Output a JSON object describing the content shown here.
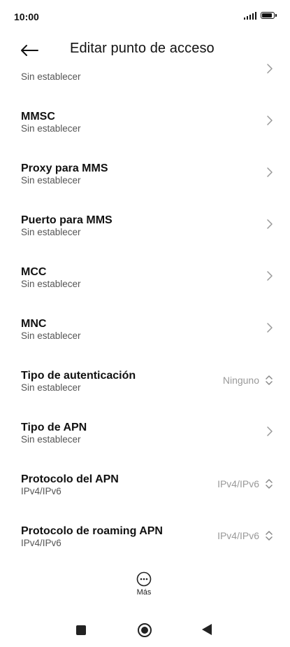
{
  "status_bar": {
    "time": "10:00"
  },
  "header": {
    "title": "Editar punto de acceso"
  },
  "rows": [
    {
      "title": "",
      "subtitle": "Sin establecer",
      "value": "",
      "control": "chevron"
    },
    {
      "title": "MMSC",
      "subtitle": "Sin establecer",
      "value": "",
      "control": "chevron"
    },
    {
      "title": "Proxy para MMS",
      "subtitle": "Sin establecer",
      "value": "",
      "control": "chevron"
    },
    {
      "title": "Puerto para MMS",
      "subtitle": "Sin establecer",
      "value": "",
      "control": "chevron"
    },
    {
      "title": "MCC",
      "subtitle": "Sin establecer",
      "value": "",
      "control": "chevron"
    },
    {
      "title": "MNC",
      "subtitle": "Sin establecer",
      "value": "",
      "control": "chevron"
    },
    {
      "title": "Tipo de autenticación",
      "subtitle": "Sin establecer",
      "value": "Ninguno",
      "control": "spinner"
    },
    {
      "title": "Tipo de APN",
      "subtitle": "Sin establecer",
      "value": "",
      "control": "chevron"
    },
    {
      "title": "Protocolo del APN",
      "subtitle": "IPv4/IPv6",
      "value": "IPv4/IPv6",
      "control": "spinner"
    },
    {
      "title": "Protocolo de roaming APN",
      "subtitle": "IPv4/IPv6",
      "value": "IPv4/IPv6",
      "control": "spinner"
    }
  ],
  "more": {
    "label": "Más"
  }
}
